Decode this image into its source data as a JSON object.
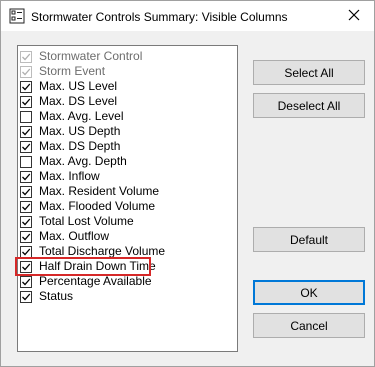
{
  "window": {
    "title": "Stormwater Controls Summary: Visible Columns"
  },
  "columns": [
    {
      "label": "Stormwater Control",
      "checked": true,
      "enabled": false
    },
    {
      "label": "Storm Event",
      "checked": true,
      "enabled": false
    },
    {
      "label": "Max. US Level",
      "checked": true,
      "enabled": true
    },
    {
      "label": "Max. DS Level",
      "checked": true,
      "enabled": true
    },
    {
      "label": "Max. Avg. Level",
      "checked": false,
      "enabled": true
    },
    {
      "label": "Max. US Depth",
      "checked": true,
      "enabled": true
    },
    {
      "label": "Max. DS Depth",
      "checked": true,
      "enabled": true
    },
    {
      "label": "Max. Avg. Depth",
      "checked": false,
      "enabled": true
    },
    {
      "label": "Max. Inflow",
      "checked": true,
      "enabled": true
    },
    {
      "label": "Max. Resident Volume",
      "checked": true,
      "enabled": true
    },
    {
      "label": "Max. Flooded Volume",
      "checked": true,
      "enabled": true
    },
    {
      "label": "Total Lost Volume",
      "checked": true,
      "enabled": true
    },
    {
      "label": "Max. Outflow",
      "checked": true,
      "enabled": true
    },
    {
      "label": "Total Discharge Volume",
      "checked": true,
      "enabled": true
    },
    {
      "label": "Half Drain Down Time",
      "checked": true,
      "enabled": true
    },
    {
      "label": "Percentage Available",
      "checked": true,
      "enabled": true
    },
    {
      "label": "Status",
      "checked": true,
      "enabled": true
    }
  ],
  "buttons": {
    "select_all": "Select All",
    "deselect_all": "Deselect All",
    "default": "Default",
    "ok": "OK",
    "cancel": "Cancel"
  },
  "highlight_color": "#d62828",
  "accent_color": "#0078d7"
}
